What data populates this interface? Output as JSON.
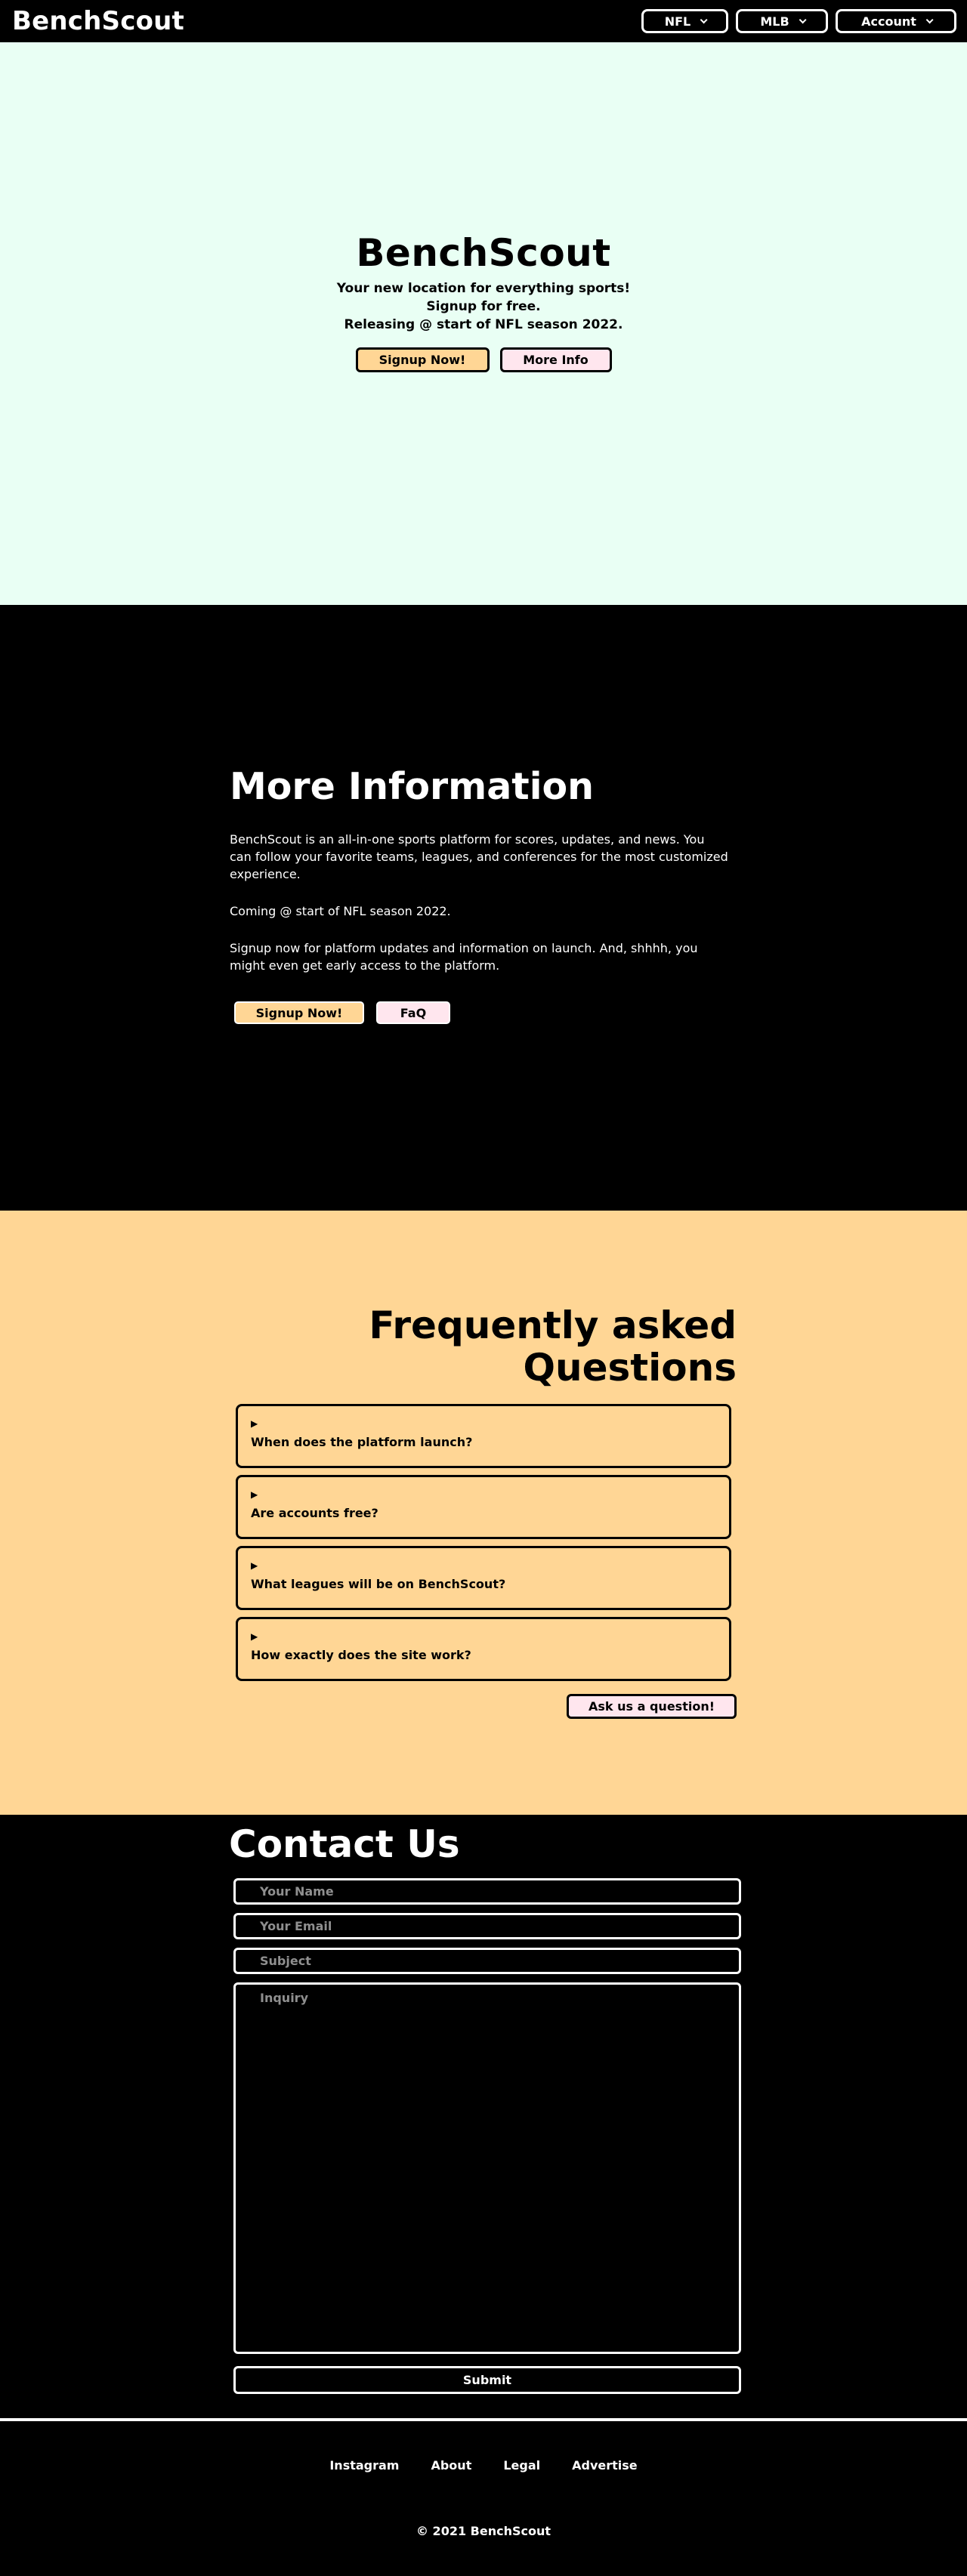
{
  "nav": {
    "brand": "BenchScout",
    "items": [
      {
        "label": "NFL"
      },
      {
        "label": "MLB"
      },
      {
        "label": "Account"
      }
    ]
  },
  "hero": {
    "title": "BenchScout",
    "lines": [
      "Your new location for everything sports!",
      "Signup for free.",
      "Releasing @ start of NFL season 2022."
    ],
    "signup_label": "Signup Now!",
    "more_info_label": "More Info"
  },
  "info": {
    "title": "More Information",
    "paragraphs": [
      "BenchScout is an all-in-one sports platform for scores, updates, and news. You can follow your favorite teams, leagues, and conferences for the most customized experience.",
      "Coming @ start of NFL season 2022.",
      "Signup now for platform updates and information on launch. And, shhhh, you might even get early access to the platform."
    ],
    "signup_label": "Signup Now!",
    "faq_label": "FaQ"
  },
  "faq": {
    "title_line1": "Frequently asked",
    "title_line2": "Questions",
    "marker": "▶",
    "questions": [
      "When does the platform launch?",
      "Are accounts free?",
      "What leagues will be on BenchScout?",
      "How exactly does the site work?"
    ],
    "ask_label": "Ask us a question!"
  },
  "contact": {
    "title": "Contact Us",
    "name_placeholder": "Your Name",
    "email_placeholder": "Your Email",
    "subject_placeholder": "Subject",
    "inquiry_placeholder": "Inquiry",
    "submit_label": "Submit"
  },
  "footer": {
    "links": [
      "Instagram",
      "About",
      "Legal",
      "Advertise"
    ],
    "copyright": "© 2021 BenchScout"
  },
  "colors": {
    "hero_bg": "#e9fff4",
    "faq_bg": "#ffd695",
    "accent_orange": "#ffd695",
    "accent_pink": "#ffe6ee",
    "dark": "#000000"
  }
}
